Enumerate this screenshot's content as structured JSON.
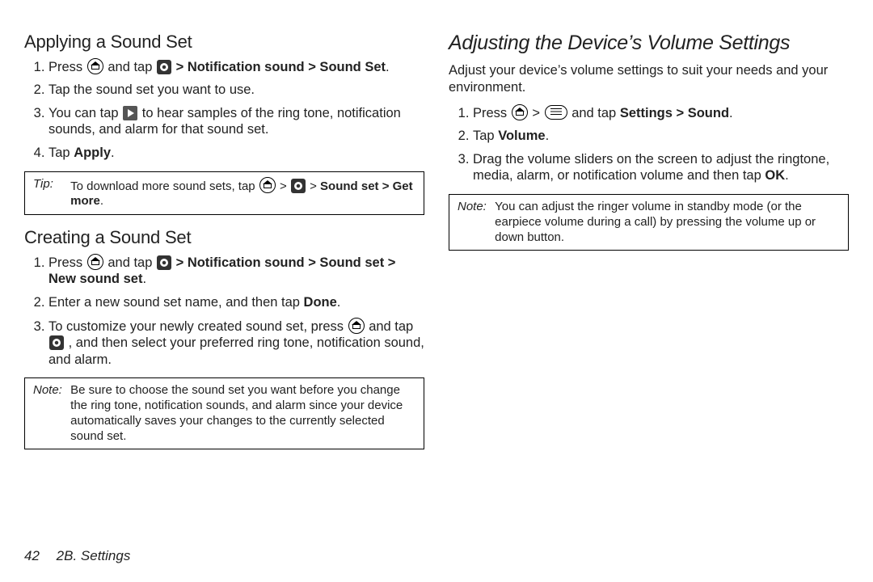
{
  "left": {
    "section1": {
      "heading": "Applying a Sound Set",
      "steps": {
        "s1a": "Press ",
        "s1b": " and tap ",
        "s1c": " > Notification sound > Sound Set",
        "s1d": ".",
        "s2": "Tap the sound set you want to use.",
        "s3a": "You can tap ",
        "s3b": " to hear samples of the ring tone, notification sounds, and alarm for that sound set.",
        "s4a": "Tap ",
        "s4b": "Apply",
        "s4c": "."
      },
      "tip": {
        "label": "Tip:",
        "a": "To download more sound sets, tap ",
        "b": " > ",
        "c": " > ",
        "d": "Sound set > Get more",
        "e": "."
      }
    },
    "section2": {
      "heading": "Creating a Sound Set",
      "steps": {
        "s1a": "Press ",
        "s1b": " and tap ",
        "s1c": " > Notification sound > Sound set > New sound set",
        "s1d": ".",
        "s2a": "Enter a new sound set name, and then tap ",
        "s2b": "Done",
        "s2c": ".",
        "s3a": "To customize your newly created sound set, press ",
        "s3b": " and tap ",
        "s3c": ", and then select your preferred ring tone, notification sound, and alarm."
      },
      "note": {
        "label": "Note:",
        "body": "Be sure to choose the sound set you want before you change the ring tone, notification sounds, and alarm since your device automatically saves your changes to the currently selected sound set."
      }
    }
  },
  "right": {
    "heading": "Adjusting the Device’s Volume Settings",
    "intro": "Adjust your device’s volume settings to suit your needs and your environment.",
    "steps": {
      "s1a": "Press ",
      "s1b": " > ",
      "s1c": " and tap ",
      "s1d": "Settings > Sound",
      "s1e": ".",
      "s2a": "Tap ",
      "s2b": "Volume",
      "s2c": ".",
      "s3a": "Drag the volume sliders on the screen to adjust the ringtone, media, alarm, or notification volume and then tap ",
      "s3b": "OK",
      "s3c": "."
    },
    "note": {
      "label": "Note:",
      "body": "You can adjust the ringer volume in standby mode (or the earpiece volume during a call) by pressing the volume up or down button."
    }
  },
  "footer": {
    "page": "42",
    "section": "2B. Settings"
  }
}
